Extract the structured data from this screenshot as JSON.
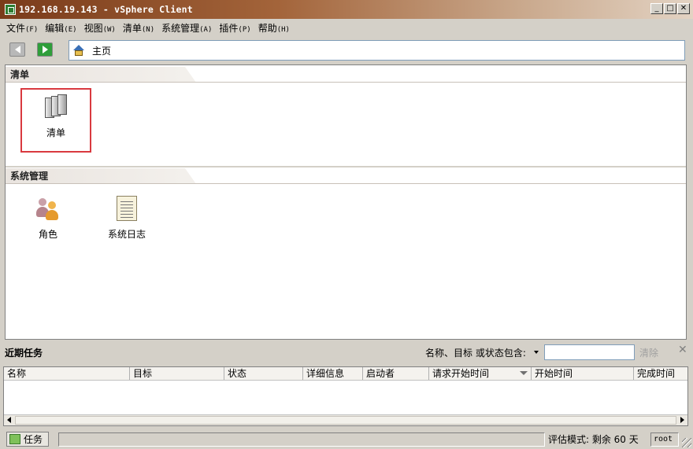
{
  "window": {
    "title": "192.168.19.143 - vSphere Client",
    "controls": {
      "minimize": "_",
      "maximize": "□",
      "close": "✕"
    }
  },
  "menu": {
    "items": [
      {
        "label": "文件",
        "accel": "(F)"
      },
      {
        "label": "编辑",
        "accel": "(E)"
      },
      {
        "label": "视图",
        "accel": "(W)"
      },
      {
        "label": "清单",
        "accel": "(N)"
      },
      {
        "label": "系统管理",
        "accel": "(A)"
      },
      {
        "label": "插件",
        "accel": "(P)"
      },
      {
        "label": "帮助",
        "accel": "(H)"
      }
    ]
  },
  "address": {
    "location": "主页"
  },
  "sections": [
    {
      "title": "清单",
      "tiles": [
        {
          "label": "清单",
          "icon": "inventory-icon",
          "selected": true
        }
      ]
    },
    {
      "title": "系统管理",
      "tiles": [
        {
          "label": "角色",
          "icon": "roles-icon"
        },
        {
          "label": "系统日志",
          "icon": "system-log-icon"
        }
      ]
    }
  ],
  "recent_tasks": {
    "title": "近期任务",
    "filter_label": "名称、目标 或状态包含:",
    "filter_value": "",
    "clear_label": "清除",
    "columns": [
      "名称",
      "目标",
      "状态",
      "详细信息",
      "启动者",
      "请求开始时间",
      "开始时间",
      "完成时间"
    ],
    "rows": []
  },
  "status": {
    "tasks_tab": "任务",
    "evaluation": "评估模式: 剩余 60 天",
    "user": "root"
  },
  "colors": {
    "selection_border": "#d9393f",
    "title_bar": "#7a3b1a"
  }
}
